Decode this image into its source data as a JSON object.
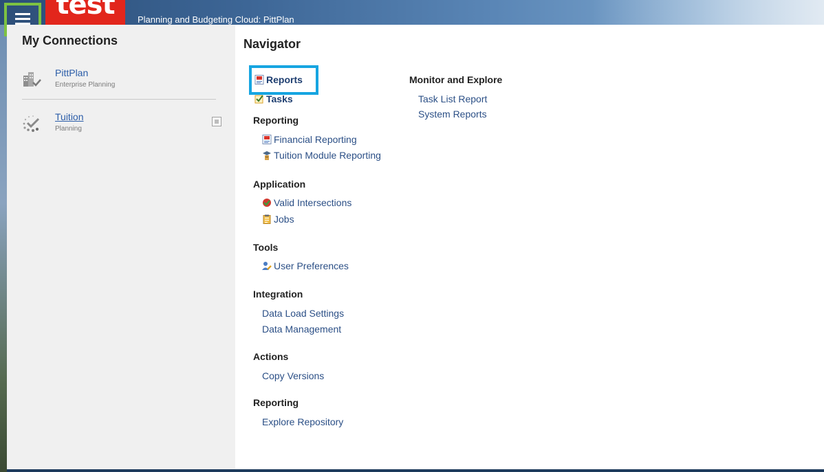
{
  "header": {
    "logo_text": "test",
    "app_title": "Planning and Budgeting Cloud: PittPlan"
  },
  "connections": {
    "title": "My Connections",
    "items": [
      {
        "name": "PittPlan",
        "subtitle": "Enterprise Planning"
      },
      {
        "name": "Tuition",
        "subtitle": "Planning"
      }
    ]
  },
  "navigator": {
    "title": "Navigator",
    "top_links": [
      {
        "label": "Reports",
        "icon": "report-doc-icon"
      },
      {
        "label": "Tasks",
        "icon": "task-checkbox-icon"
      }
    ],
    "sections": [
      {
        "heading": "Reporting",
        "items": [
          {
            "label": "Financial Reporting",
            "icon": "report-doc-icon"
          },
          {
            "label": "Tuition Module Reporting",
            "icon": "graduate-icon"
          }
        ]
      },
      {
        "heading": "Application",
        "items": [
          {
            "label": "Valid Intersections",
            "icon": "valid-intersections-icon"
          },
          {
            "label": "Jobs",
            "icon": "clipboard-icon"
          }
        ]
      },
      {
        "heading": "Tools",
        "items": [
          {
            "label": "User Preferences",
            "icon": "user-preferences-icon"
          }
        ]
      },
      {
        "heading": "Integration",
        "items": [
          {
            "label": "Data Load Settings"
          },
          {
            "label": "Data Management"
          }
        ]
      },
      {
        "heading": "Actions",
        "items": [
          {
            "label": "Copy Versions"
          }
        ]
      },
      {
        "heading": "Reporting",
        "items": [
          {
            "label": "Explore Repository"
          }
        ]
      }
    ],
    "monitor": {
      "heading": "Monitor and Explore",
      "items": [
        {
          "label": "Task List Report"
        },
        {
          "label": "System Reports"
        }
      ]
    }
  },
  "colors": {
    "highlight_menu": "#7dc242",
    "highlight_reports": "#16a5e1",
    "link": "#2b4f86",
    "logo_red": "#e2261c"
  }
}
